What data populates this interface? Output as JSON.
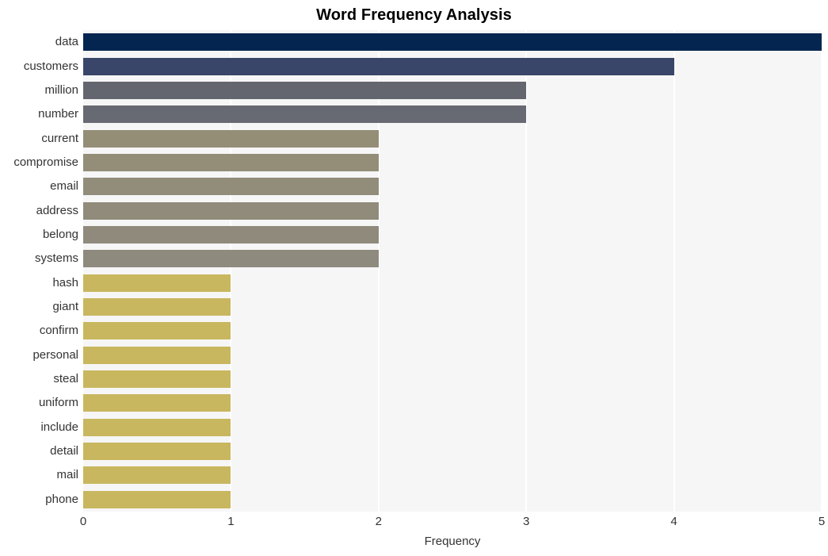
{
  "chart_data": {
    "type": "bar",
    "orientation": "horizontal",
    "title": "Word Frequency Analysis",
    "xlabel": "Frequency",
    "ylabel": "",
    "xlim": [
      0,
      5
    ],
    "xticks": [
      0,
      1,
      2,
      3,
      4,
      5
    ],
    "xtick_labels": [
      "0",
      "1",
      "2",
      "3",
      "4",
      "5"
    ],
    "grid": true,
    "grid_axis": "x",
    "legend": false,
    "plot_background": "#f6f6f7",
    "gridline_color": "#ffffff",
    "categories": [
      "data",
      "customers",
      "million",
      "number",
      "current",
      "compromise",
      "email",
      "address",
      "belong",
      "systems",
      "hash",
      "giant",
      "confirm",
      "personal",
      "steal",
      "uniform",
      "include",
      "detail",
      "mail",
      "phone"
    ],
    "values": [
      5,
      4,
      3,
      3,
      2,
      2,
      2,
      2,
      2,
      2,
      1,
      1,
      1,
      1,
      1,
      1,
      1,
      1,
      1,
      1
    ],
    "bar_colors": [
      "#032550",
      "#3a4669",
      "#63666e",
      "#676a73",
      "#958e77",
      "#948e78",
      "#928c7a",
      "#918b7b",
      "#8f8a7c",
      "#8e8a7e",
      "#c9b75f",
      "#c9b75f",
      "#c9b75f",
      "#c9b75f",
      "#c9b75f",
      "#c9b75f",
      "#c9b75f",
      "#c9b75f",
      "#c9b75f",
      "#c9b75f"
    ]
  }
}
